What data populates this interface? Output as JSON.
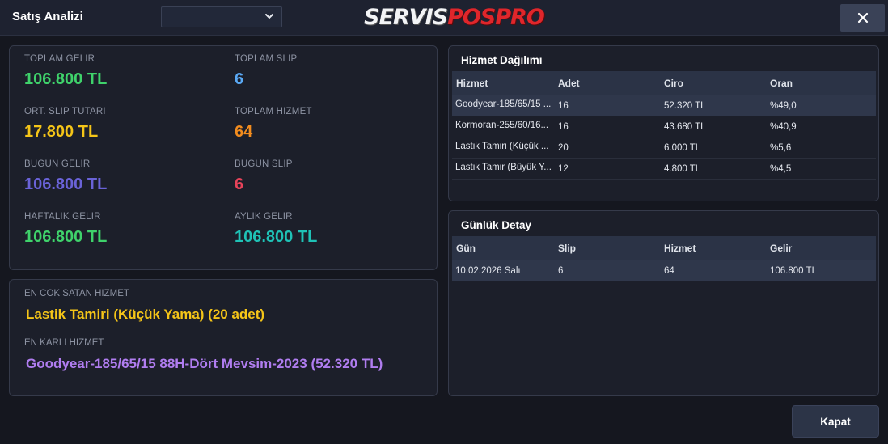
{
  "header": {
    "title": "Satış Analizi",
    "period_select_value": "",
    "logo_part1": "SERVIS",
    "logo_part2": "POSPRO",
    "close_icon": "close-icon"
  },
  "stats": [
    {
      "label": "TOPLAM GELIR",
      "value": "106.800 TL",
      "color": "#3fd26b"
    },
    {
      "label": "TOPLAM SLIP",
      "value": "6",
      "color": "#5aa9f5"
    },
    {
      "label": "ORT. SLIP TUTARI",
      "value": "17.800 TL",
      "color": "#f5c518"
    },
    {
      "label": "TOPLAM HIZMET",
      "value": "64",
      "color": "#f28c1e"
    },
    {
      "label": "BUGUN GELIR",
      "value": "106.800 TL",
      "color": "#6a63d8"
    },
    {
      "label": "BUGUN SLIP",
      "value": "6",
      "color": "#e8435a"
    },
    {
      "label": "HAFTALIK GELIR",
      "value": "106.800 TL",
      "color": "#3fd26b"
    },
    {
      "label": "AYLIK GELIR",
      "value": "106.800 TL",
      "color": "#1fc2b6"
    }
  ],
  "best": {
    "top_label": "EN COK SATAN HIZMET",
    "top_value": "Lastik Tamiri (Küçük Yama) (20 adet)",
    "top_color": "#f5c518",
    "profit_label": "EN KARLI HIZMET",
    "profit_value": "Goodyear-185/65/15 88H-Dört Mevsim-2023 (52.320 TL)",
    "profit_color": "#b07df0"
  },
  "hizmet": {
    "title": "Hizmet Dağılımı",
    "headers": [
      "Hizmet",
      "Adet",
      "Ciro",
      "Oran"
    ],
    "rows": [
      [
        "Goodyear-185/65/15 ...",
        "16",
        "52.320 TL",
        "%49,0"
      ],
      [
        "Kormoran-255/60/16...",
        "16",
        "43.680 TL",
        "%40,9"
      ],
      [
        "Lastik Tamiri (Küçük ...",
        "20",
        "6.000 TL",
        "%5,6"
      ],
      [
        "Lastik Tamir (Büyük Y...",
        "12",
        "4.800 TL",
        "%4,5"
      ]
    ]
  },
  "gunluk": {
    "title": "Günlük Detay",
    "headers": [
      "Gün",
      "Slip",
      "Hizmet",
      "Gelir"
    ],
    "rows": [
      [
        "10.02.2026 Salı",
        "6",
        "64",
        "106.800 TL"
      ]
    ]
  },
  "footer": {
    "kapat_label": "Kapat"
  }
}
